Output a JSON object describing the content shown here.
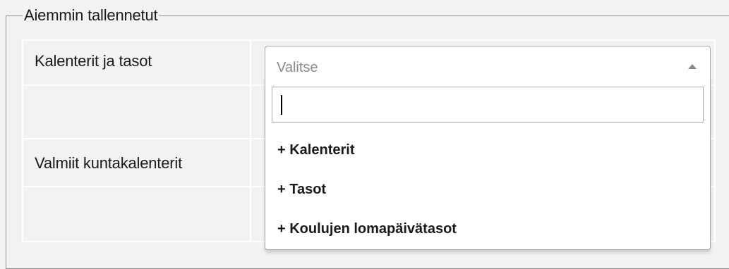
{
  "fieldset": {
    "legend": "Aiemmin tallennetut"
  },
  "form": {
    "calendars_label": "Kalenterit ja tasot",
    "municipal_label": "Valmiit kuntakalenterit"
  },
  "select": {
    "placeholder": "Valitse",
    "search_value": "",
    "options": [
      "+ Kalenterit",
      "+ Tasot",
      "+ Koulujen lomapäivätasot"
    ]
  }
}
